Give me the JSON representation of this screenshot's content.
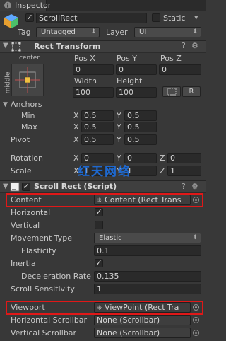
{
  "tab": {
    "title": "Inspector"
  },
  "object": {
    "name": "ScrollRect",
    "active": true,
    "static_label": "Static",
    "tag_label": "Tag",
    "tag_value": "Untagged",
    "layer_label": "Layer",
    "layer_value": "UI"
  },
  "rect_transform": {
    "title": "Rect Transform",
    "anchor_h": "center",
    "anchor_v": "middle",
    "pos_x_label": "Pos X",
    "pos_y_label": "Pos Y",
    "pos_z_label": "Pos Z",
    "pos_x": "0",
    "pos_y": "0",
    "pos_z": "0",
    "width_label": "Width",
    "height_label": "Height",
    "width": "100",
    "height": "100",
    "r_button": "R",
    "anchors_label": "Anchors",
    "min_label": "Min",
    "max_label": "Max",
    "min_x": "0.5",
    "min_y": "0.5",
    "max_x": "0.5",
    "max_y": "0.5",
    "pivot_label": "Pivot",
    "pivot_x": "0.5",
    "pivot_y": "0.5",
    "rotation_label": "Rotation",
    "rot_x": "0",
    "rot_y": "0",
    "rot_z": "0",
    "scale_label": "Scale",
    "scale_x": "1",
    "scale_y": "1",
    "scale_z": "1",
    "x": "X",
    "y": "Y",
    "z": "Z"
  },
  "watermark": "红天网络",
  "scroll_rect": {
    "title": "Scroll Rect (Script)",
    "enabled": true,
    "content_label": "Content",
    "content_value": "Content (Rect Trans",
    "horizontal_label": "Horizontal",
    "horizontal": true,
    "vertical_label": "Vertical",
    "vertical": false,
    "movement_type_label": "Movement Type",
    "movement_type": "Elastic",
    "elasticity_label": "Elasticity",
    "elasticity": "0.1",
    "inertia_label": "Inertia",
    "inertia": true,
    "deceleration_label": "Deceleration Rate",
    "deceleration": "0.135",
    "sensitivity_label": "Scroll Sensitivity",
    "sensitivity": "1",
    "viewport_label": "Viewport",
    "viewport_value": "ViewPoint (Rect Tra",
    "h_scrollbar_label": "Horizontal Scrollbar",
    "h_scrollbar_value": "None (Scrollbar)",
    "v_scrollbar_label": "Vertical Scrollbar",
    "v_scrollbar_value": "None (Scrollbar)"
  },
  "colors": {
    "highlight": "#e01818",
    "background": "#383838",
    "watermark": "#1d6fe0"
  }
}
